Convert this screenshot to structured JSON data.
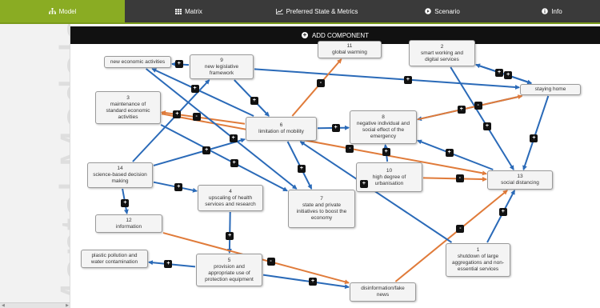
{
  "tabs": [
    {
      "label": "Model",
      "icon": "hierarchy-icon",
      "active": true
    },
    {
      "label": "Matrix",
      "icon": "grid-icon",
      "active": false
    },
    {
      "label": "Preferred State & Metrics",
      "icon": "line-chart-icon",
      "active": false
    },
    {
      "label": "Scenario",
      "icon": "play-circle-icon",
      "active": false
    },
    {
      "label": "Info",
      "icon": "info-icon",
      "active": false
    }
  ],
  "sidebar": {
    "watermark": "Mental Modeler"
  },
  "toolbar": {
    "add_component": "ADD COMPONENT"
  },
  "colors": {
    "positive": "#2a6ab8",
    "negative": "#e07b3a",
    "accent": "#8aac23",
    "dark": "#111111"
  },
  "nodes": [
    {
      "id": "n_new_econ",
      "num": "",
      "label": "new economic activities"
    },
    {
      "id": "n9",
      "num": "9",
      "label": "new legislative\nframework"
    },
    {
      "id": "n11",
      "num": "11",
      "label": "global warming"
    },
    {
      "id": "n2",
      "num": "2",
      "label": "smart working and\ndigital services"
    },
    {
      "id": "n_staying",
      "num": "",
      "label": "staying home"
    },
    {
      "id": "n3",
      "num": "3",
      "label": "maintenance of\nstandard economic\nactivities"
    },
    {
      "id": "n6",
      "num": "6",
      "label": "limitation of mobility"
    },
    {
      "id": "n8",
      "num": "8",
      "label": "negative individual and\nsocial effect of the\nemergency"
    },
    {
      "id": "n14",
      "num": "14",
      "label": "science-based decision\nmaking"
    },
    {
      "id": "n4",
      "num": "4",
      "label": "upscaling of health\nservices and research"
    },
    {
      "id": "n7",
      "num": "7",
      "label": "state and private\ninitiatives to boost the\neconomy"
    },
    {
      "id": "n10",
      "num": "10",
      "label": "high degree of\nurbanisation"
    },
    {
      "id": "n13",
      "num": "13",
      "label": "social distancing"
    },
    {
      "id": "n12",
      "num": "12",
      "label": "information"
    },
    {
      "id": "n_plastic",
      "num": "",
      "label": "plastic pollution and\nwater contamination"
    },
    {
      "id": "n5",
      "num": "5",
      "label": "provision and\nappropriate use of\nprotection equipment"
    },
    {
      "id": "n1",
      "num": "1",
      "label": "shutdown of large\naggregations and non-\nessential services"
    },
    {
      "id": "n_disinfo",
      "num": "",
      "label": "disinformation/fake\nnews"
    }
  ],
  "edges": [
    {
      "from": "n9",
      "to": "n_new_econ",
      "sign": "+"
    },
    {
      "from": "n9",
      "to": "n6",
      "sign": "+"
    },
    {
      "from": "n9",
      "to": "n_staying",
      "sign": "+"
    },
    {
      "from": "n6",
      "to": "n_new_econ",
      "sign": "+"
    },
    {
      "from": "n6",
      "to": "n11",
      "sign": "-"
    },
    {
      "from": "n6",
      "to": "n3",
      "sign": "-"
    },
    {
      "from": "n6",
      "to": "n8",
      "sign": "+"
    },
    {
      "from": "n6",
      "to": "n7",
      "sign": "+"
    },
    {
      "from": "n2",
      "to": "n_staying",
      "sign": "+"
    },
    {
      "from": "n_staying",
      "to": "n2",
      "sign": "+"
    },
    {
      "from": "n_staying",
      "to": "n8",
      "sign": "+"
    },
    {
      "from": "n_staying",
      "to": "n13",
      "sign": "+"
    },
    {
      "from": "n2",
      "to": "n13",
      "sign": "+"
    },
    {
      "from": "n8",
      "to": "n_staying",
      "sign": "-"
    },
    {
      "from": "n13",
      "to": "n8",
      "sign": "+"
    },
    {
      "from": "n3",
      "to": "n13",
      "sign": "-"
    },
    {
      "from": "n3",
      "to": "n7",
      "sign": "+"
    },
    {
      "from": "n10",
      "to": "n13",
      "sign": "-"
    },
    {
      "from": "n10",
      "to": "n8",
      "sign": "+"
    },
    {
      "from": "n14",
      "to": "n9",
      "sign": "+"
    },
    {
      "from": "n14",
      "to": "n6",
      "sign": "+"
    },
    {
      "from": "n14",
      "to": "n4",
      "sign": "+"
    },
    {
      "from": "n14",
      "to": "n12",
      "sign": "+"
    },
    {
      "from": "n_new_econ",
      "to": "n7",
      "sign": "+"
    },
    {
      "from": "n4",
      "to": "n5",
      "sign": "+"
    },
    {
      "from": "n12",
      "to": "n_disinfo",
      "sign": "-"
    },
    {
      "from": "n5",
      "to": "n_plastic",
      "sign": "+"
    },
    {
      "from": "n5",
      "to": "n_disinfo",
      "sign": "+"
    },
    {
      "from": "n_disinfo",
      "to": "n13",
      "sign": "-"
    },
    {
      "from": "n1",
      "to": "n13",
      "sign": "+"
    },
    {
      "from": "n1",
      "to": "n6",
      "sign": "+"
    }
  ]
}
